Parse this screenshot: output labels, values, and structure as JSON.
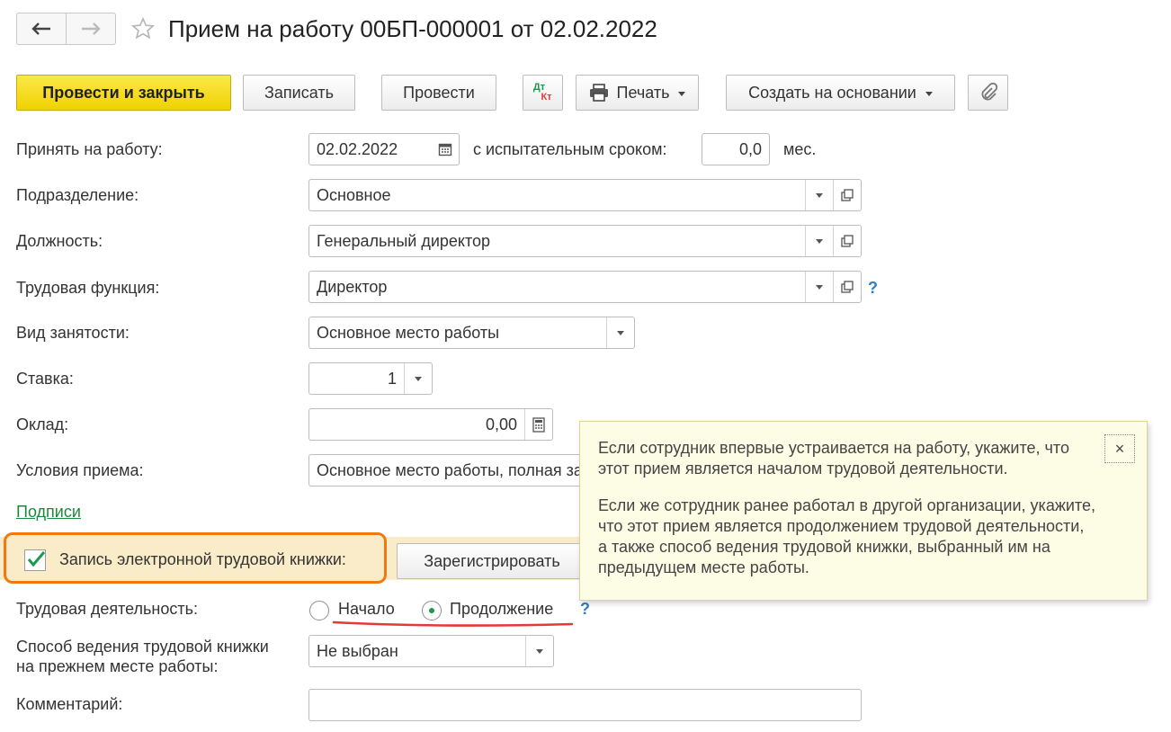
{
  "header": {
    "title": "Прием на работу 00БП-000001 от 02.02.2022",
    "back_icon": "arrow-left-icon",
    "forward_icon": "arrow-right-icon",
    "favorite_icon": "star-icon"
  },
  "toolbar": {
    "post_close": "Провести и закрыть",
    "save": "Записать",
    "post": "Провести",
    "dtkt_top": "Дт",
    "dtkt_bottom": "Кт",
    "print": "Печать",
    "create_based": "Создать на основании",
    "attach_icon": "paperclip-icon"
  },
  "form": {
    "hire_date_label": "Принять на работу:",
    "hire_date": "02.02.2022",
    "probation_label": "с испытательным сроком:",
    "probation_value": "0,0",
    "probation_unit": "мес.",
    "department_label": "Подразделение:",
    "department": "Основное",
    "position_label": "Должность:",
    "position": "Генеральный директор",
    "labor_function_label": "Трудовая функция:",
    "labor_function": "Директор",
    "help_mark": "?",
    "employment_type_label": "Вид занятости:",
    "employment_type": "Основное место работы",
    "rate_label": "Ставка:",
    "rate": "1",
    "salary_label": "Оклад:",
    "salary": "0,00",
    "conditions_label": "Условия приема:",
    "conditions": "Основное место работы, полная занятость",
    "signatures_link": "Подписи",
    "etk_label": "Запись электронной трудовой книжки:",
    "etk_checked": true,
    "register_button": "Зарегистрировать",
    "labor_activity_label": "Трудовая деятельность:",
    "radio_start": "Начало",
    "radio_continue": "Продолжение",
    "radio_selected": "Продолжение",
    "book_method_label_1": "Способ ведения трудовой книжки",
    "book_method_label_2": "на прежнем месте работы:",
    "book_method": "Не выбран",
    "comment_label": "Комментарий:",
    "comment": ""
  },
  "tooltip": {
    "p1": "Если сотрудник впервые устраивается на работу, укажите, что этот прием является началом трудовой деятельности.",
    "p2": "Если же сотрудник ранее работал в другой организации, укажите, что этот прием является продолжением трудовой деятельности, а также способ ведения трудовой книжки, выбранный им на предыдущем месте работы.",
    "close": "×"
  },
  "colors": {
    "primary_button": "#f5dc1e",
    "highlight_border": "#f07a10",
    "annotation_underline": "#e53935",
    "link": "#1a8a3a",
    "help": "#2f7fc1"
  }
}
